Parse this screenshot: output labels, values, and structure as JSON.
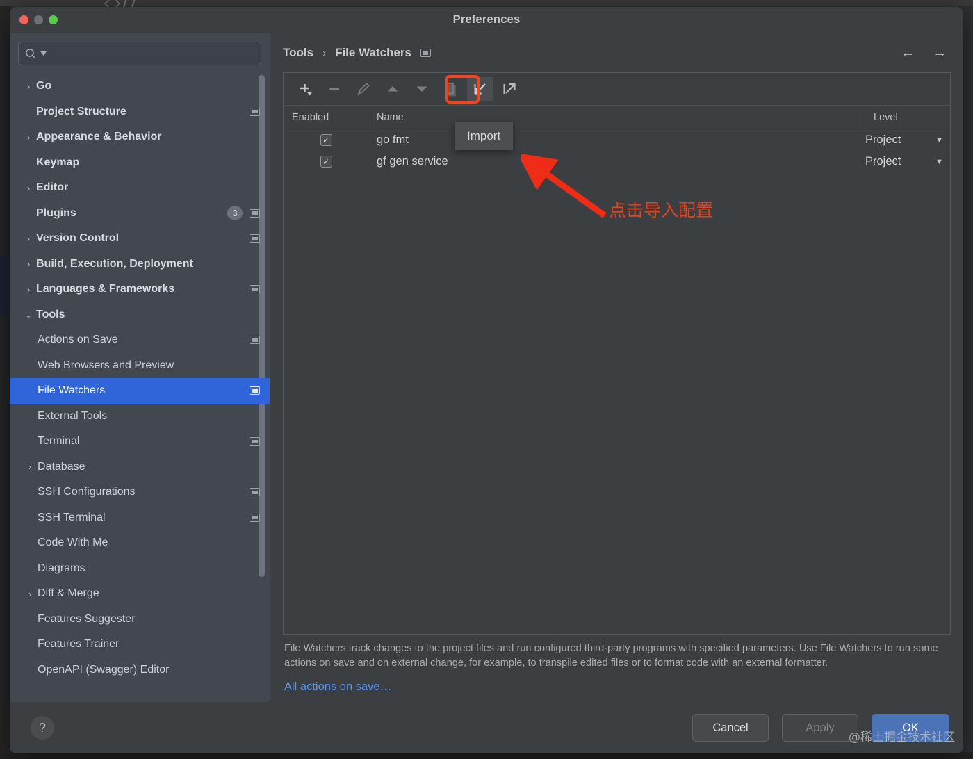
{
  "window": {
    "title": "Preferences",
    "traffic_lights": [
      "close-button",
      "minimize-button",
      "zoom-button"
    ]
  },
  "sidebar": {
    "search": {
      "value": "",
      "placeholder": ""
    },
    "items": [
      {
        "label": "Go",
        "twisty": "›",
        "depth": 1,
        "bold": true,
        "monitor": false
      },
      {
        "label": "Project Structure",
        "twisty": "",
        "depth": 1,
        "bold": true,
        "monitor": true
      },
      {
        "label": "Appearance & Behavior",
        "twisty": "›",
        "depth": 1,
        "bold": true,
        "monitor": false
      },
      {
        "label": "Keymap",
        "twisty": "",
        "depth": 1,
        "bold": true,
        "monitor": false
      },
      {
        "label": "Editor",
        "twisty": "›",
        "depth": 1,
        "bold": true,
        "monitor": false
      },
      {
        "label": "Plugins",
        "twisty": "",
        "depth": 1,
        "bold": true,
        "monitor": true,
        "badge": "3"
      },
      {
        "label": "Version Control",
        "twisty": "›",
        "depth": 1,
        "bold": true,
        "monitor": true
      },
      {
        "label": "Build, Execution, Deployment",
        "twisty": "›",
        "depth": 1,
        "bold": true,
        "monitor": false
      },
      {
        "label": "Languages & Frameworks",
        "twisty": "›",
        "depth": 1,
        "bold": true,
        "monitor": true
      },
      {
        "label": "Tools",
        "twisty": "⌄",
        "depth": 1,
        "bold": true,
        "monitor": false,
        "expanded": true
      },
      {
        "label": "Actions on Save",
        "twisty": "",
        "depth": 2,
        "bold": false,
        "monitor": true
      },
      {
        "label": "Web Browsers and Preview",
        "twisty": "",
        "depth": 2,
        "bold": false,
        "monitor": false
      },
      {
        "label": "File Watchers",
        "twisty": "",
        "depth": 2,
        "bold": false,
        "monitor": true,
        "selected": true
      },
      {
        "label": "External Tools",
        "twisty": "",
        "depth": 2,
        "bold": false,
        "monitor": false
      },
      {
        "label": "Terminal",
        "twisty": "",
        "depth": 2,
        "bold": false,
        "monitor": true
      },
      {
        "label": "Database",
        "twisty": "›",
        "depth": 2,
        "bold": false,
        "monitor": false
      },
      {
        "label": "SSH Configurations",
        "twisty": "",
        "depth": 2,
        "bold": false,
        "monitor": true
      },
      {
        "label": "SSH Terminal",
        "twisty": "",
        "depth": 2,
        "bold": false,
        "monitor": true
      },
      {
        "label": "Code With Me",
        "twisty": "",
        "depth": 2,
        "bold": false,
        "monitor": false
      },
      {
        "label": "Diagrams",
        "twisty": "",
        "depth": 2,
        "bold": false,
        "monitor": false
      },
      {
        "label": "Diff & Merge",
        "twisty": "›",
        "depth": 2,
        "bold": false,
        "monitor": false
      },
      {
        "label": "Features Suggester",
        "twisty": "",
        "depth": 2,
        "bold": false,
        "monitor": false
      },
      {
        "label": "Features Trainer",
        "twisty": "",
        "depth": 2,
        "bold": false,
        "monitor": false
      },
      {
        "label": "OpenAPI (Swagger) Editor",
        "twisty": "",
        "depth": 2,
        "bold": false,
        "monitor": false
      }
    ]
  },
  "breadcrumb": {
    "parent": "Tools",
    "separator": "›",
    "current": "File Watchers",
    "back_arrow": "←",
    "forward_arrow": "→"
  },
  "toolbar": {
    "buttons": [
      {
        "name": "add-button",
        "glyph": "+",
        "enabled": true
      },
      {
        "name": "remove-button",
        "glyph": "−",
        "enabled": false
      },
      {
        "name": "edit-button",
        "glyph": "pencil-icon",
        "enabled": false
      },
      {
        "name": "move-up-button",
        "glyph": "▲",
        "enabled": false
      },
      {
        "name": "move-down-button",
        "glyph": "▼",
        "enabled": false
      },
      {
        "name": "copy-button",
        "glyph": "copy-icon",
        "enabled": false
      },
      {
        "name": "import-button",
        "glyph": "import-icon",
        "enabled": true,
        "highlighted": true
      },
      {
        "name": "export-button",
        "glyph": "export-icon",
        "enabled": true
      }
    ],
    "tooltip": "Import"
  },
  "table": {
    "columns": [
      "Enabled",
      "Name",
      "Level"
    ],
    "rows": [
      {
        "enabled": true,
        "check": "✓",
        "name": "go fmt",
        "level": "Project",
        "caret": "▼"
      },
      {
        "enabled": true,
        "check": "✓",
        "name": "gf gen service",
        "level": "Project",
        "caret": "▼"
      }
    ]
  },
  "description": {
    "text": "File Watchers track changes to the project files and run configured third-party programs with specified parameters. Use File Watchers to run some actions on save and on external change, for example, to transpile edited files or to format code with an external formatter.",
    "link": "All actions on save…"
  },
  "footer": {
    "help": "?",
    "cancel": "Cancel",
    "apply": "Apply",
    "ok": "OK",
    "watermark": "@稀土掘金技术社区"
  },
  "annotation": {
    "text": "点击导入配置",
    "color": "#e0441f"
  },
  "colors": {
    "accent_selected": "#2f65d8",
    "primary_button": "#4b73b8",
    "link": "#5a93f0",
    "highlight_box": "#f2441d",
    "sidebar_bg": "#434750",
    "panel_bg": "#3c3f41"
  }
}
